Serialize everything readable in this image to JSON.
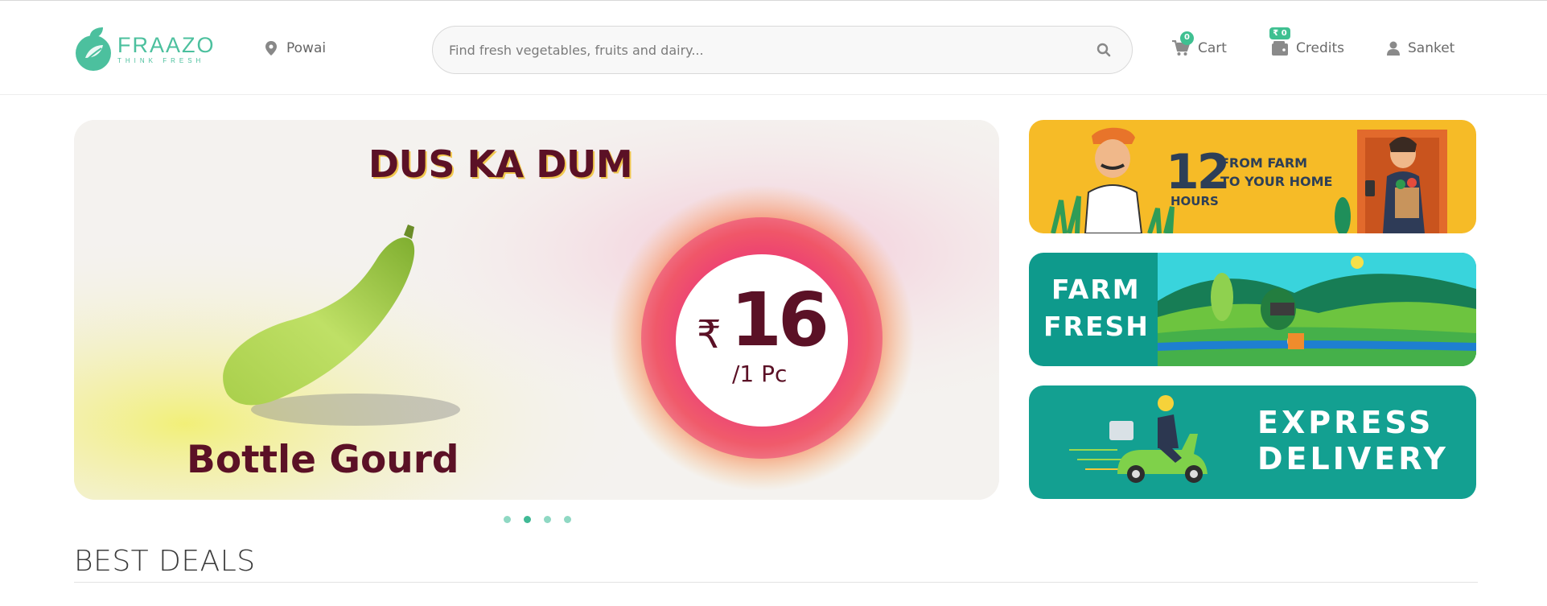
{
  "header": {
    "logo": {
      "name": "FRAAZO",
      "tagline": "THINK FRESH"
    },
    "location": {
      "label": "Powai",
      "icon": "map-pin-icon"
    },
    "search": {
      "placeholder": "Find fresh vegetables, fruits and dairy...",
      "icon": "search-icon"
    },
    "cart": {
      "label": "Cart",
      "count": "0",
      "icon": "cart-icon"
    },
    "credits": {
      "label": "Credits",
      "amount": "₹ 0",
      "icon": "wallet-icon"
    },
    "user": {
      "label": "Sanket",
      "icon": "user-icon"
    }
  },
  "hero": {
    "headline": "DUS KA DUM",
    "product": "Bottle Gourd",
    "price_symbol": "₹",
    "price": "16",
    "unit": "/1 Pc"
  },
  "side_banners": {
    "hours": {
      "number": "12",
      "number_label": "HOURS",
      "line1": "FROM FARM",
      "line2": "TO YOUR HOME"
    },
    "farm_fresh": {
      "line1": "FARM",
      "line2": "FRESH"
    },
    "express": {
      "line1": "EXPRESS",
      "line2": "DELIVERY"
    }
  },
  "carousel": {
    "slides": 4,
    "active": 2
  },
  "sections": {
    "best_deals": "BEST DEALS"
  },
  "colors": {
    "brand_green": "#4cc09e",
    "hero_text": "#5b1126",
    "yellow_banner": "#f6bb27",
    "teal_banner": "#0fa08f"
  }
}
